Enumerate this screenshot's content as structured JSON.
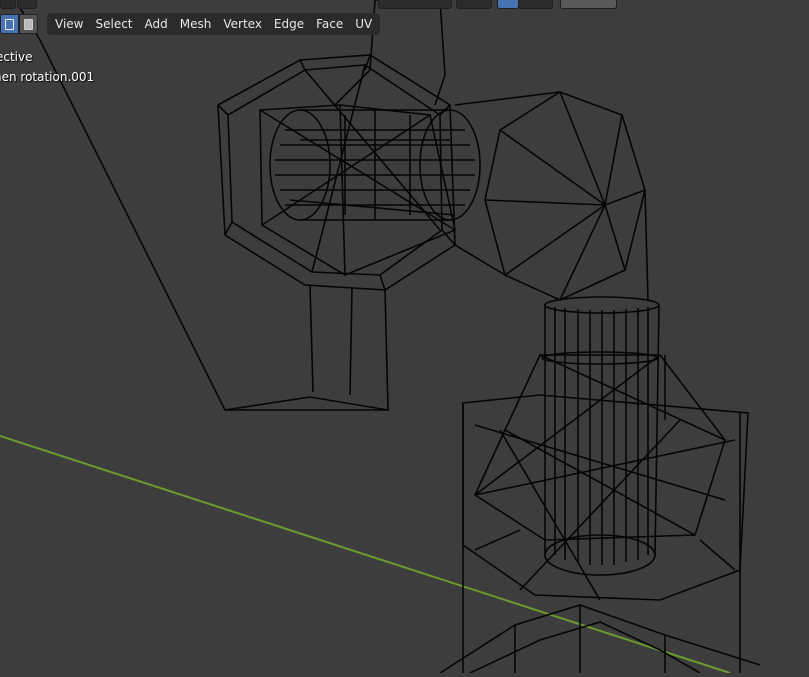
{
  "viewport": {
    "view_mode": "ective",
    "object_name": "hen rotation.001"
  },
  "header": {
    "menu_items": [
      "View",
      "Select",
      "Add",
      "Mesh",
      "Vertex",
      "Edge",
      "Face",
      "UV"
    ]
  },
  "colors": {
    "background": "#3d3d3d",
    "wire": "#000000",
    "axis_x": "#6c9a2c",
    "toggle_active": "#4772b3"
  },
  "icons": [
    "xray-toggle-icon",
    "xray-alt-icon"
  ]
}
